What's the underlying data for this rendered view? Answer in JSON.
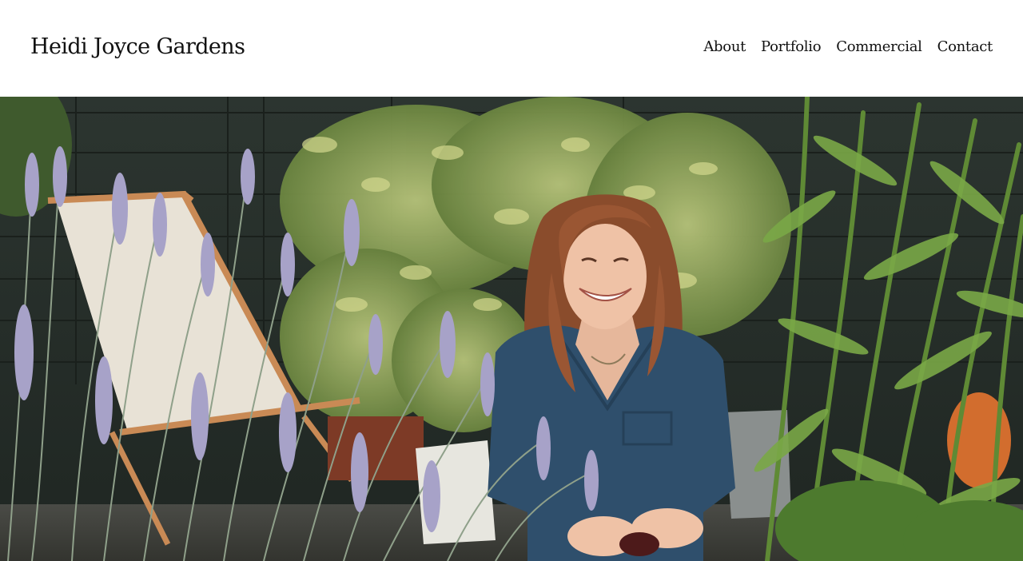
{
  "site": {
    "title": "Heidi Joyce Gardens"
  },
  "nav": {
    "items": [
      {
        "label": "About"
      },
      {
        "label": "Portfolio"
      },
      {
        "label": "Commercial"
      },
      {
        "label": "Contact"
      }
    ]
  },
  "colors": {
    "text": "#111111",
    "background": "#ffffff",
    "fence": "#27302b",
    "foliage": "#6f8a3e",
    "lavender": "#a7a2c8",
    "shirt": "#2f4f6c",
    "hair": "#8a4c2c",
    "deckchair_frame": "#c98a55",
    "deckchair_canvas": "#e8e2d6"
  }
}
